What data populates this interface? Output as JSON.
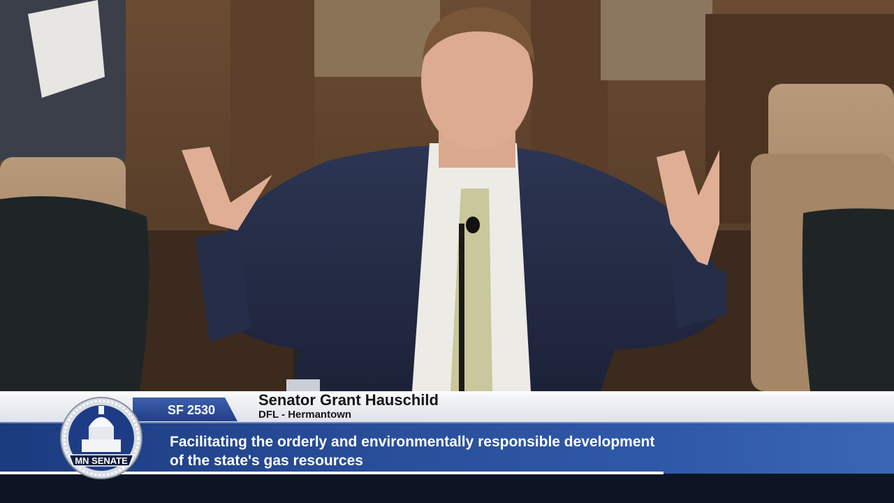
{
  "broadcast": {
    "bill_number": "SF 2530",
    "speaker_name": "Senator Grant Hauschild",
    "speaker_party_district": "DFL - Hermantown",
    "topic_line1": "Facilitating the orderly and environmentally responsible development",
    "topic_line2": "of the state's gas resources",
    "seal_label": "MN SENATE"
  },
  "colors": {
    "accent_blue": "#2a4f9b",
    "dark_navy": "#0d1424",
    "strip_light": "#eef0f4"
  },
  "icons": {
    "seal": "capitol-dome-seal-icon"
  }
}
